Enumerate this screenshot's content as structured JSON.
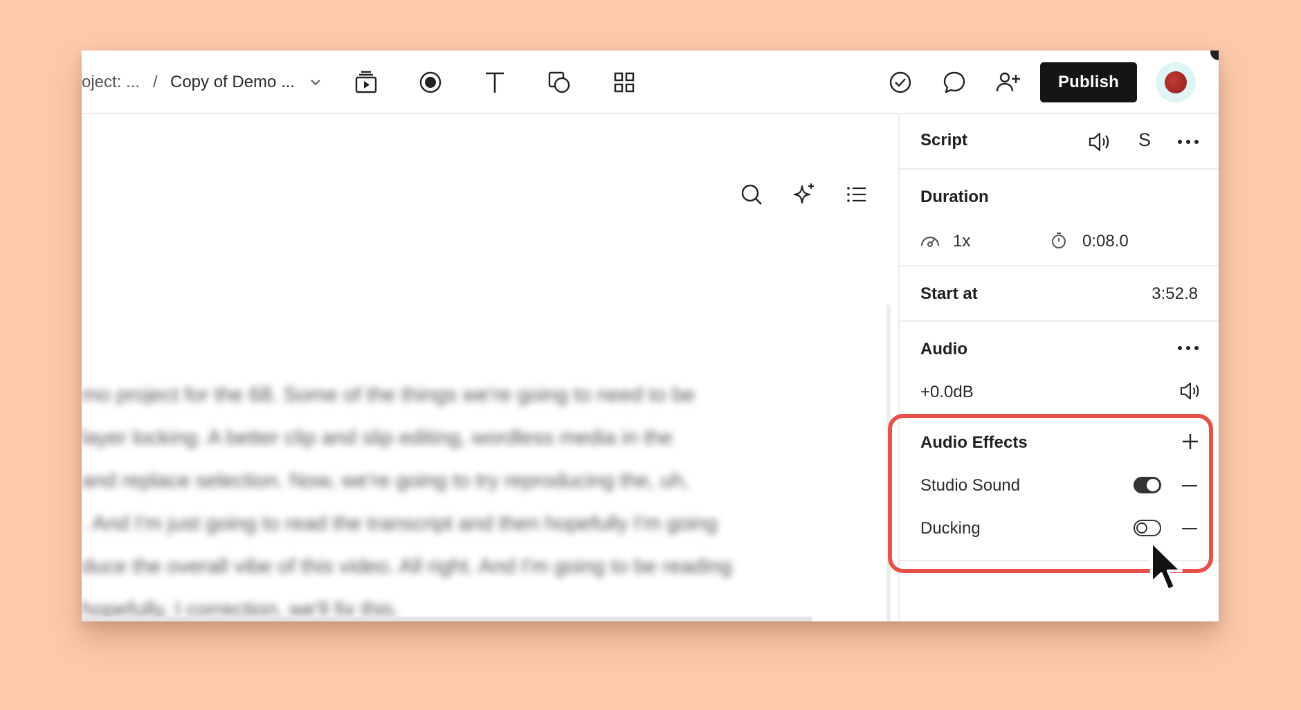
{
  "toolbar": {
    "breadcrumb_project": "oject: ...",
    "breadcrumb_sep": "/",
    "breadcrumb_doc": "Copy of Demo ...",
    "publish_label": "Publish"
  },
  "transcript": {
    "lines": [
      "mo project for the 68. Some of the things we're going to need to be",
      "layer locking. A better clip and slip editing, wordless media in the",
      "and replace selection. Now, we're going to try reproducing the, uh,",
      ". And I'm just going to read the transcript and then hopefully I'm going",
      "duce the overall vibe of this video. All right. And I'm going to be reading",
      "hopefully, I correction, we'll fix this."
    ]
  },
  "panel": {
    "header_title": "Script",
    "header_letter": "S",
    "duration": {
      "title": "Duration",
      "speed": "1x",
      "time": "0:08.0"
    },
    "start_at": {
      "label": "Start at",
      "value": "3:52.8"
    },
    "audio": {
      "title": "Audio",
      "gain": "+0.0dB"
    },
    "audio_effects": {
      "title": "Audio Effects",
      "effects": [
        {
          "name": "Studio Sound",
          "enabled": true
        },
        {
          "name": "Ducking",
          "enabled": false
        }
      ]
    }
  },
  "colors": {
    "background": "#fcc9ad",
    "highlight": "#e8504a",
    "publish_bg": "#151515"
  }
}
